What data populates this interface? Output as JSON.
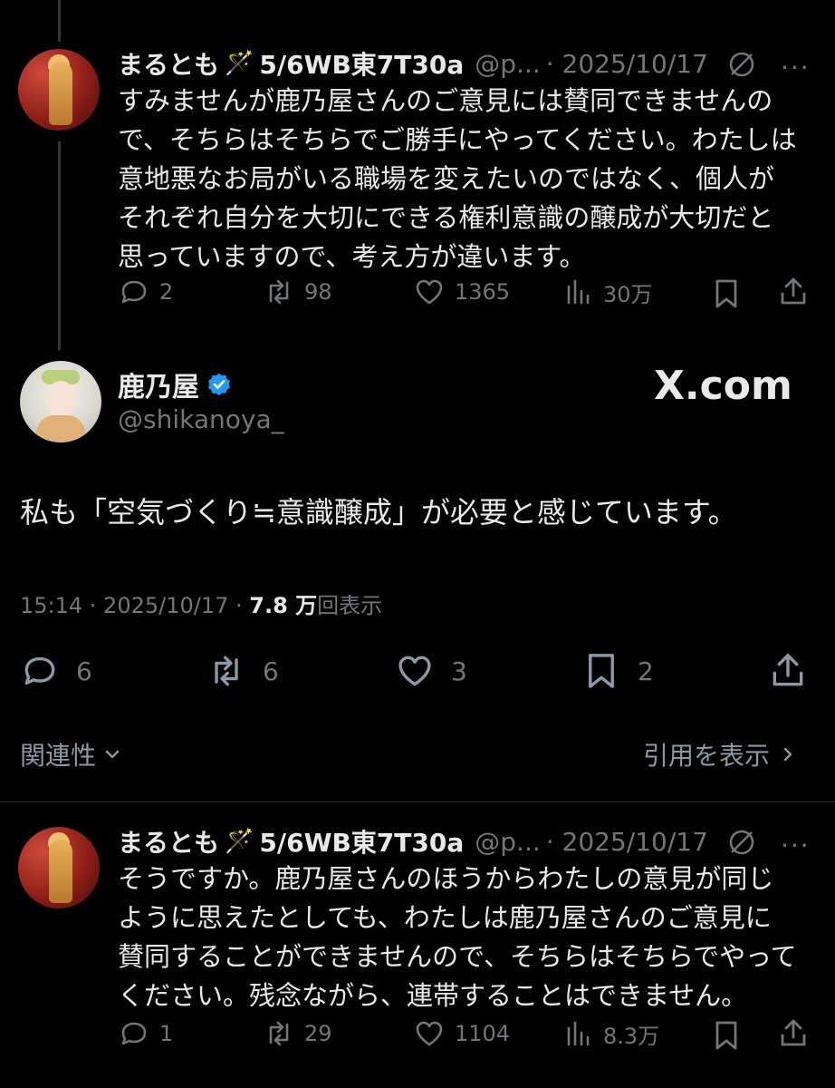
{
  "reply1": {
    "name": "まるとも",
    "name_suffix": "5/6WB東7T30a",
    "handle": "@p...",
    "date": "· 2025/10/17",
    "text": "すみませんが鹿乃屋さんのご意見には賛同できませんので、そちらはそちらでご勝手にやってください。わたしは意地悪なお局がいる職場を変えたいのではなく、個人がそれぞれ自分を大切にできる権利意識の醸成が大切だと思っていますので、考え方が違います。",
    "stats": {
      "replies": "2",
      "reposts": "98",
      "likes": "1365",
      "views": "30万"
    }
  },
  "main": {
    "name": "鹿乃屋",
    "handle": "@shikanoya_",
    "watermark": "X.com",
    "text": "私も「空気づくり≒意識醸成」が必要と感じています。",
    "time": "15:14 · 2025/10/17 ·",
    "views_count": "7.8 万",
    "views_label": "回表示",
    "stats": {
      "replies": "6",
      "reposts": "6",
      "likes": "3",
      "bookmarks": "2"
    }
  },
  "sort": {
    "label": "関連性",
    "quotes_label": "引用を表示"
  },
  "reply2": {
    "name": "まるとも",
    "name_suffix": "5/6WB東7T30a",
    "handle": "@p...",
    "date": "· 2025/10/17",
    "text": "そうですか。鹿乃屋さんのほうからわたしの意見が同じように思えたとしても、わたしは鹿乃屋さんのご意見に賛同することができませんので、そちらはそちらでやってください。残念ながら、連帯することはできません。",
    "stats": {
      "replies": "1",
      "reposts": "29",
      "likes": "1104",
      "views": "8.3万"
    }
  }
}
